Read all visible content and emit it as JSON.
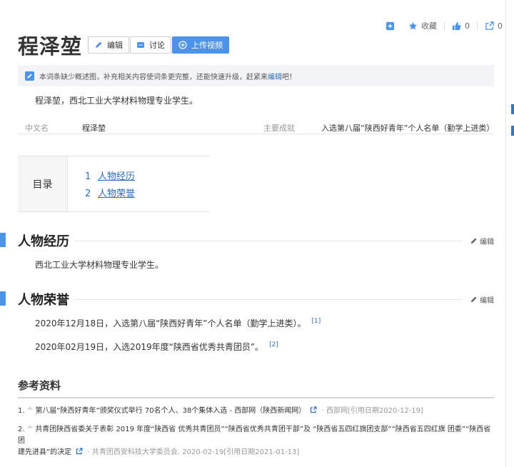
{
  "header": {
    "title": "程泽堃",
    "edit_label": "编辑",
    "discuss_label": "讨论",
    "upload_video_label": "上传视频",
    "favorite_label": "收藏",
    "like_count": "0",
    "share_count": "0"
  },
  "notice": {
    "text_before": "本词条缺少概述图，补充相关内容使词条更完整，还能快速升级，赶紧来",
    "link": "编辑",
    "text_after": "吧！"
  },
  "summary": "程泽堃，西北工业大学材料物理专业学生。",
  "infobox": {
    "k1": "中文名",
    "v1": "程泽堃",
    "k2": "主要成就",
    "v2": "入选第八届“陕西好青年”个人名单（勤学上进类）"
  },
  "toc": {
    "label": "目录",
    "items": [
      {
        "num": "1",
        "text": "人物经历"
      },
      {
        "num": "2",
        "text": "人物荣誉"
      }
    ]
  },
  "sections": {
    "s1": {
      "title": "人物经历",
      "edit": "编辑",
      "text": "西北工业大学材料物理专业学生。"
    },
    "s2": {
      "title": "人物荣誉",
      "edit": "编辑",
      "items": [
        {
          "text": "2020年12月18日，入选第八届“陕西好青年”个人名单（勤学上进类）。",
          "ref": "[1]"
        },
        {
          "text": "2020年02月19日，入选2019年度“陕西省优秀共青团员”。",
          "ref": "[2]"
        }
      ]
    }
  },
  "references": {
    "title": "参考资料",
    "items": [
      {
        "num": "1.",
        "text": "第八届“陕西好青年”颁奖仪式举行 70名个人、38个集体入选 - 西部网（陕西新闻网）",
        "meta": "· 西部网[引用日期2020-12-19]"
      },
      {
        "num": "2.",
        "text_line1": "共青团陕西省委关于表彰 2019 年度“陕西省 优秀共青团员”“陕西省优秀共青团干部”及 “陕西省五四红旗团支部”“陕西省五四红旗 团委”“陕西省团",
        "text_line2": "建先进县”的决定",
        "meta": "· 共青团西安科技大学委员会. 2020-02-19[引用日期2021-01-13]"
      }
    ]
  },
  "colors": {
    "accent": "#4d94e8",
    "link": "#2f6fb8"
  }
}
